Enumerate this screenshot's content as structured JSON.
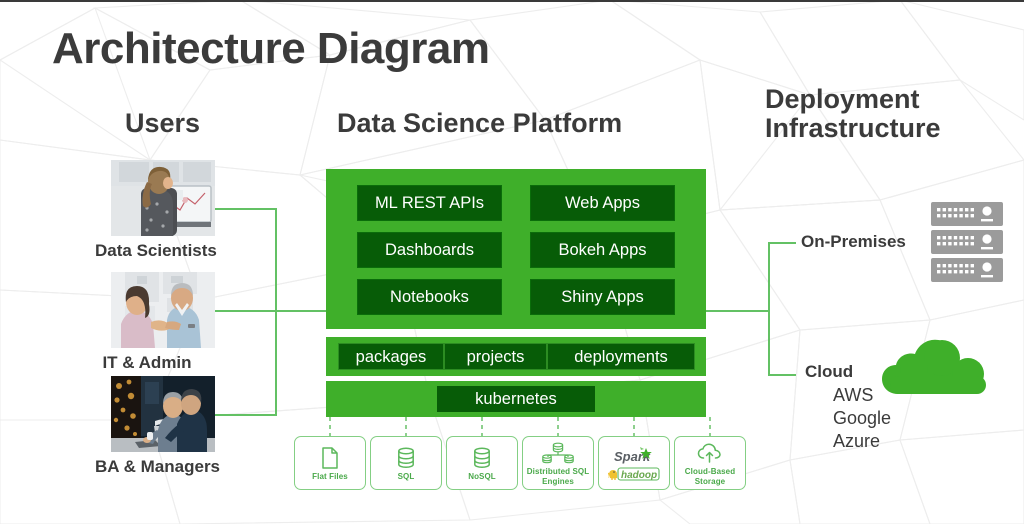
{
  "title": "Architecture Diagram",
  "columns": {
    "users_heading": "Users",
    "platform_heading": "Data Science Platform",
    "deployment_heading": "Deployment Infrastructure"
  },
  "users": [
    {
      "label": "Data Scientists",
      "photo": "woman-at-monitor-photo"
    },
    {
      "label": "IT & Admin",
      "photo": "handshake-office-photo"
    },
    {
      "label": "BA & Managers",
      "photo": "two-men-laptop-photo"
    }
  ],
  "platform": {
    "apps": [
      "ML REST APIs",
      "Web Apps",
      "Dashboards",
      "Bokeh Apps",
      "Notebooks",
      "Shiny Apps"
    ],
    "management_layer": [
      "packages",
      "projects",
      "deployments"
    ],
    "orchestration_layer": "kubernetes"
  },
  "data_sources": [
    {
      "label": "Flat Files",
      "icon": "document-file-icon"
    },
    {
      "label": "SQL",
      "icon": "database-cylinder-icon"
    },
    {
      "label": "NoSQL",
      "icon": "database-cylinder-icon"
    },
    {
      "label": "Distributed SQL Engines",
      "icon": "distributed-database-icon"
    },
    {
      "label": "",
      "icon": "spark-hadoop-logo",
      "logos": [
        "Spark",
        "hadoop"
      ]
    },
    {
      "label": "Cloud-Based Storage",
      "icon": "cloud-upload-icon"
    }
  ],
  "deployment": {
    "on_premises": {
      "label": "On-Premises",
      "icon": "server-rack-icon"
    },
    "cloud": {
      "label": "Cloud",
      "icon": "cloud-icon",
      "vendors": "AWS\nGoogle\nAzure",
      "vendor_list": [
        "AWS",
        "Google",
        "Azure"
      ]
    }
  },
  "colors": {
    "panel_green": "#3faf2a",
    "chip_dark_green": "#075c07",
    "connector_green": "#63c164",
    "source_outline_green": "#84cf84",
    "heading_gray": "#3b3b3b",
    "server_gray": "#9b9b9b",
    "mesh_gray": "#ededed"
  }
}
